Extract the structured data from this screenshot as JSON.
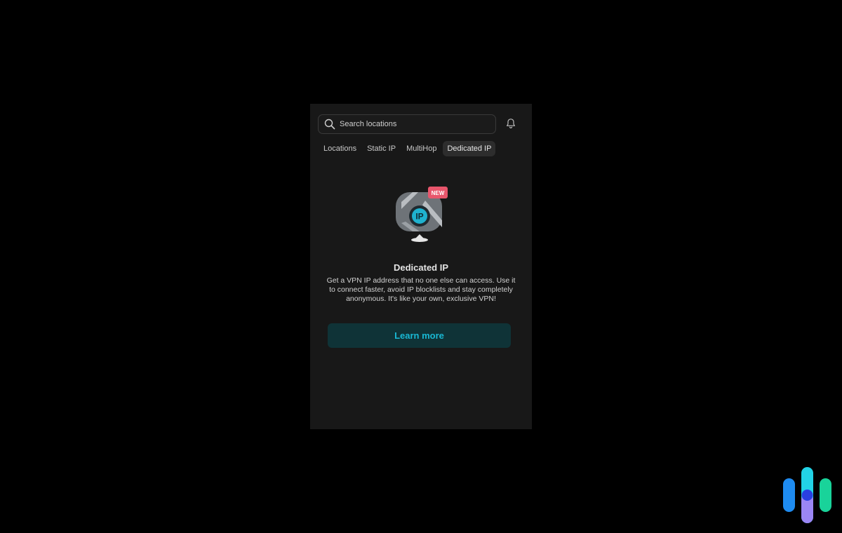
{
  "search": {
    "placeholder": "Search locations",
    "icon": "search-icon"
  },
  "header": {
    "notification_icon": "bell-icon"
  },
  "tabs": [
    {
      "label": "Locations",
      "active": false
    },
    {
      "label": "Static IP",
      "active": false
    },
    {
      "label": "MultiHop",
      "active": false
    },
    {
      "label": "Dedicated IP",
      "active": true
    }
  ],
  "feature": {
    "badge": "NEW",
    "icon_text": "IP",
    "title": "Dedicated IP",
    "description": "Get a VPN IP address that no one else can access. Use it to connect faster, avoid IP blocklists and stay completely anonymous. It's like your own, exclusive VPN!",
    "button_label": "Learn more"
  },
  "colors": {
    "background": "#000000",
    "panel": "#181818",
    "accent": "#19b8d4",
    "button_bg": "#0f3337",
    "badge": "#e8566c"
  }
}
